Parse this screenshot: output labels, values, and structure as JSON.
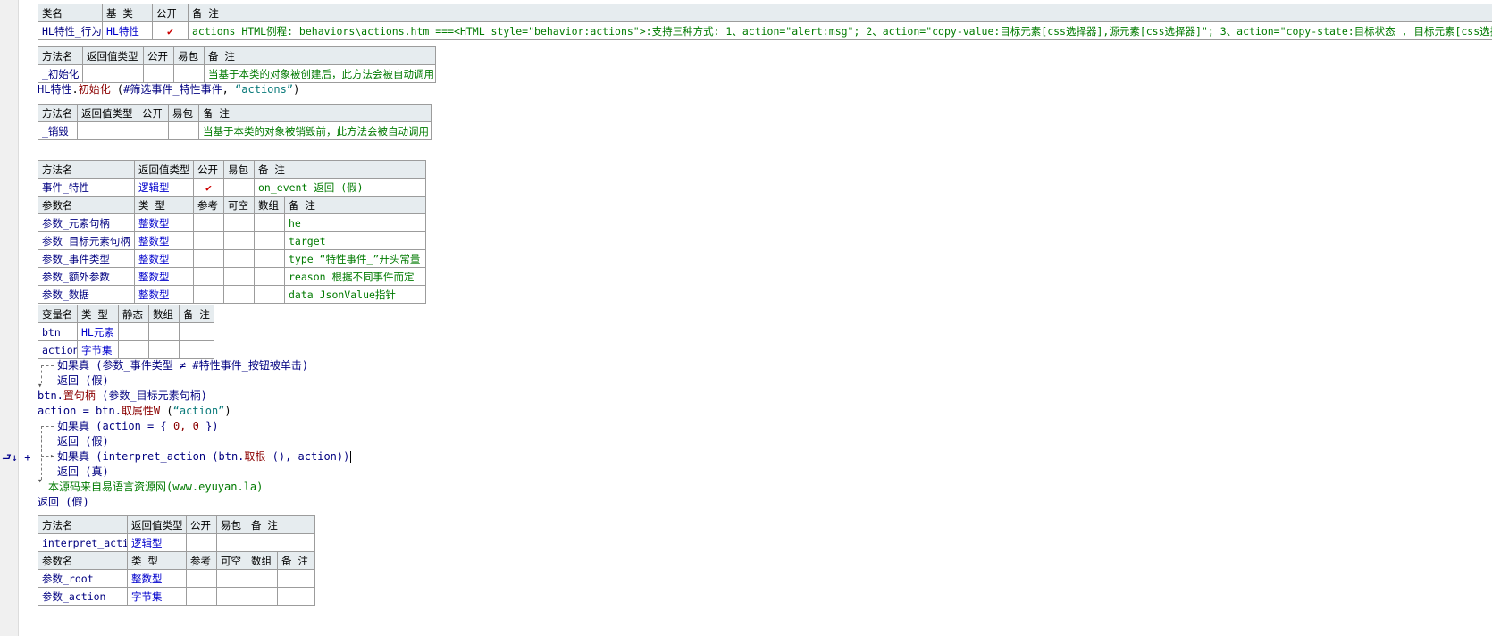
{
  "class_table": {
    "headers": [
      "类名",
      "基 类",
      "公开",
      "备 注"
    ],
    "name": "HL特性_行为",
    "base": "HL特性",
    "public_mark": "✔",
    "note": "actions HTML例程: behaviors\\actions.htm  ===<HTML style=\"behavior:actions\">:支持三种方式: 1、action=\"alert:msg\"; 2、action=\"copy-value:目标元素[css选择器],源元素[css选择器]\"; 3、action=\"copy-state:目标状态 , 目标元素[css选择器] , 源状态, 源"
  },
  "init_method": {
    "headers": [
      "方法名",
      "返回值类型",
      "公开",
      "易包",
      "备 注"
    ],
    "name": "_初始化",
    "note": "当基于本类的对象被创建后，此方法会被自动调用"
  },
  "init_call": {
    "obj": "HL特性",
    "dot": ".",
    "method": "初始化",
    "args_open": " (",
    "const": "#筛选事件_特性事件",
    "sep": ", ",
    "str": "“actions”",
    "args_close": ")"
  },
  "destroy_method": {
    "headers": [
      "方法名",
      "返回值类型",
      "公开",
      "易包",
      "备 注"
    ],
    "name": "_销毁",
    "note": "当基于本类的对象被销毁前，此方法会被自动调用"
  },
  "event_method": {
    "headers": [
      "方法名",
      "返回值类型",
      "公开",
      "易包",
      "备 注"
    ],
    "name": "事件_特性",
    "return_type": "逻辑型",
    "public_mark": "✔",
    "note": "on_event 返回 (假)",
    "param_headers": [
      "参数名",
      "类 型",
      "参考",
      "可空",
      "数组",
      "备 注"
    ],
    "params": [
      {
        "name": "参数_元素句柄",
        "type": "整数型",
        "note": "he"
      },
      {
        "name": "参数_目标元素句柄",
        "type": "整数型",
        "note": "target"
      },
      {
        "name": "参数_事件类型",
        "type": "整数型",
        "note": "type “特性事件_”开头常量"
      },
      {
        "name": "参数_额外参数",
        "type": "整数型",
        "note": "reason 根据不同事件而定"
      },
      {
        "name": "参数_数据",
        "type": "整数型",
        "note": "data JsonValue指针"
      }
    ]
  },
  "vars_table": {
    "headers": [
      "变量名",
      "类 型",
      "静态",
      "数组",
      "备 注"
    ],
    "rows": [
      {
        "name": "btn",
        "type": "HL元素"
      },
      {
        "name": "action",
        "type": "字节集"
      }
    ]
  },
  "code": {
    "l1_kw": "如果真",
    "l1_rest": " (参数_事件类型 ≠ #特性事件_按钮被单击)",
    "l2": "返回 (假)",
    "l3_obj": "btn.",
    "l3_method": "置句柄",
    "l3_rest": " (参数_目标元素句柄)",
    "l4_pre": "action = btn.",
    "l4_method": "取属性W",
    "l4_mid": " (",
    "l4_str": "“action”",
    "l4_end": ")",
    "l5_kw": "如果真",
    "l5_pre": " (action = { ",
    "l5_nums": "0, 0",
    "l5_end": " })",
    "l6": "返回 (假)",
    "l7_kw": "如果真",
    "l7_pre": " (interpret_action (btn.",
    "l7_method": "取根",
    "l7_end": " (), action))",
    "l8": "返回 (真)",
    "l9_comment": "本源码来自易语言资源网(www.eyuyan.la)",
    "l10": "返回 (假)"
  },
  "gutter_icons": "⮐↓ +",
  "interpret_method": {
    "headers": [
      "方法名",
      "返回值类型",
      "公开",
      "易包",
      "备 注"
    ],
    "name": "interpret_action",
    "return_type": "逻辑型",
    "param_headers": [
      "参数名",
      "类 型",
      "参考",
      "可空",
      "数组",
      "备 注"
    ],
    "params": [
      {
        "name": "参数_root",
        "type": "整数型"
      },
      {
        "name": "参数_action",
        "type": "字节集"
      }
    ]
  }
}
